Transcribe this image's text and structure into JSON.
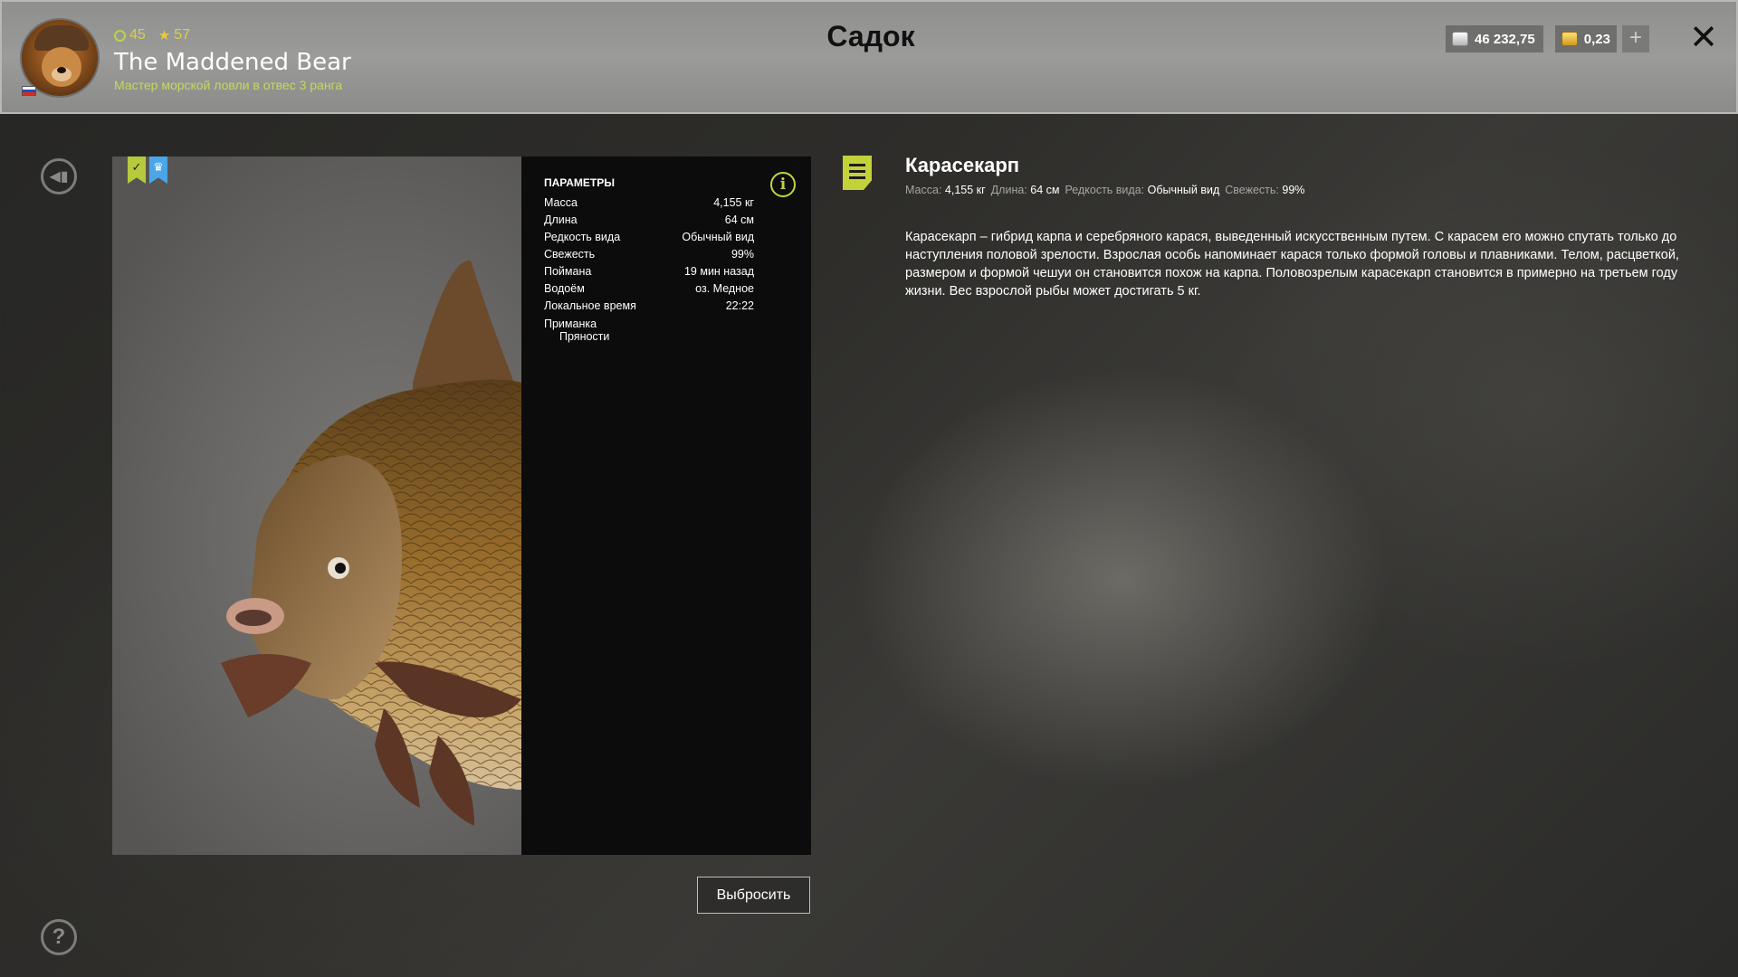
{
  "header": {
    "title": "Садок",
    "player": {
      "level": "45",
      "stars": "57",
      "name": "The Maddened Bear",
      "rank": "Мастер морской ловли в отвес 3 ранга"
    },
    "currency": {
      "silver": "46 232,75",
      "gold": "0,23"
    }
  },
  "icons": {
    "back": "back-arrow-icon",
    "help": "question-icon",
    "close": "close-icon",
    "plus": "plus-icon",
    "info": "info-icon",
    "note": "notes-icon"
  },
  "colors": {
    "accent": "#c4d23a",
    "rank": "#c8d85a",
    "badge_blue": "#4aa6e8"
  },
  "params": {
    "title": "ПАРАМЕТРЫ",
    "rows": [
      {
        "label": "Масса",
        "value": "4,155 кг"
      },
      {
        "label": "Длина",
        "value": "64 см"
      },
      {
        "label": "Редкость вида",
        "value": "Обычный вид"
      },
      {
        "label": "Свежесть",
        "value": "99%"
      },
      {
        "label": "Поймана",
        "value": "19 мин назад"
      },
      {
        "label": "Водоём",
        "value": "оз. Медное"
      },
      {
        "label": "Локальное время",
        "value": "22:22"
      }
    ],
    "bait_label": "Приманка",
    "bait_value": "Пряности"
  },
  "discard_label": "Выбросить",
  "fish": {
    "name": "Карасекарп",
    "meta": [
      {
        "label": "Масса:",
        "value": "4,155 кг"
      },
      {
        "label": "Длина:",
        "value": "64 см"
      },
      {
        "label": "Редкость вида:",
        "value": "Обычный вид"
      },
      {
        "label": "Свежесть:",
        "value": "99%"
      }
    ],
    "description": "Карасекарп – гибрид карпа и серебряного карася, выведенный искусственным путем. С карасем его можно спутать только до наступления половой зрелости. Взрослая особь напоминает карася только формой головы и плавниками. Телом, расцветкой, размером и формой чешуи он становится похож на карпа. Половозрелым карасекарп становится в примерно на третьем году жизни. Вес взрослой рыбы может достигать 5 кг."
  }
}
